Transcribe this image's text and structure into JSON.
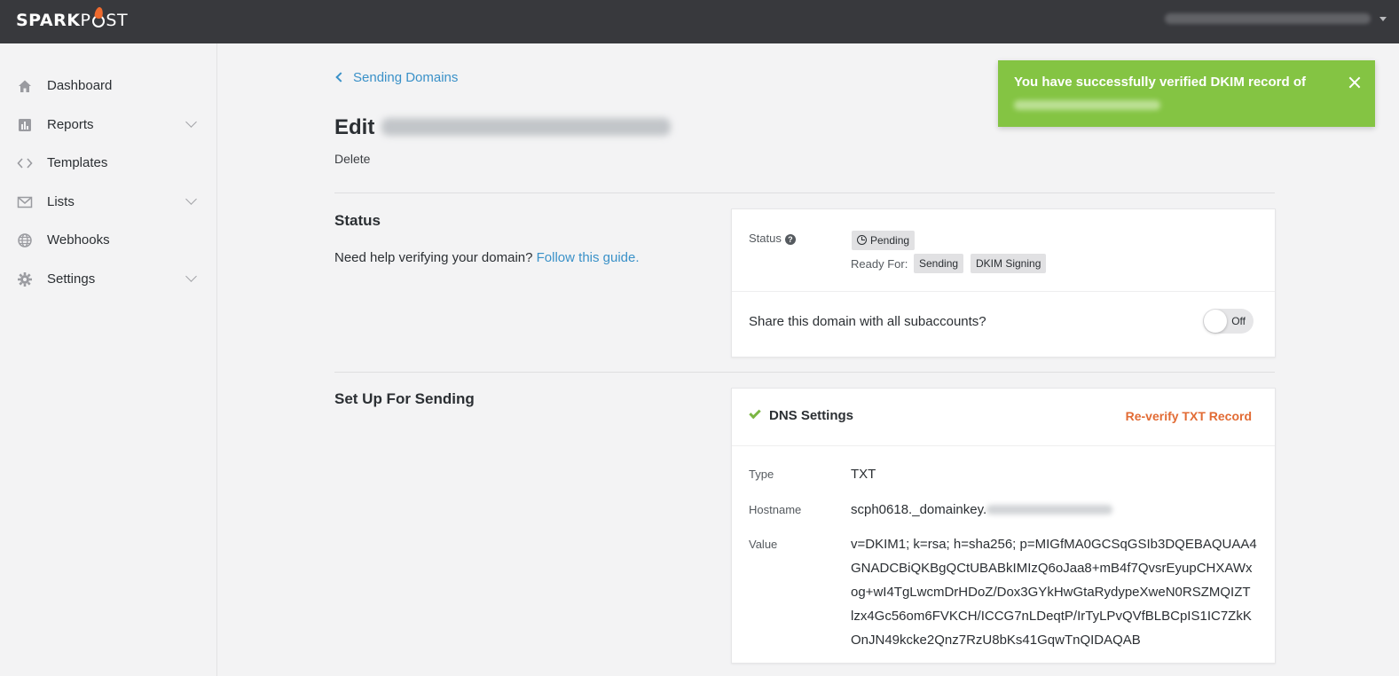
{
  "app": {
    "logo_left": "SPARK",
    "logo_right": "ST"
  },
  "sidebar": {
    "items": [
      {
        "label": "Dashboard",
        "icon": "home-icon",
        "expandable": false
      },
      {
        "label": "Reports",
        "icon": "bar-chart-icon",
        "expandable": true
      },
      {
        "label": "Templates",
        "icon": "code-icon",
        "expandable": false
      },
      {
        "label": "Lists",
        "icon": "envelope-icon",
        "expandable": true
      },
      {
        "label": "Webhooks",
        "icon": "globe-icon",
        "expandable": false
      },
      {
        "label": "Settings",
        "icon": "gear-icon",
        "expandable": true
      }
    ]
  },
  "page": {
    "breadcrumb": "Sending Domains",
    "title_prefix": "Edit",
    "delete_label": "Delete"
  },
  "status_section": {
    "heading": "Status",
    "help_text": "Need help verifying your domain?",
    "help_link": "Follow this guide.",
    "status_label": "Status",
    "status_value": "Pending",
    "ready_for_label": "Ready For:",
    "ready_for_tags": [
      "Sending",
      "DKIM Signing"
    ],
    "share_question": "Share this domain with all subaccounts?",
    "share_toggle": "Off"
  },
  "sending_section": {
    "heading": "Set Up For Sending",
    "dns_title": "DNS Settings",
    "reverify_label": "Re-verify TXT Record",
    "type_label": "Type",
    "type_value": "TXT",
    "hostname_label": "Hostname",
    "hostname_value": "scph0618._domainkey.",
    "value_label": "Value",
    "value_lines": [
      "v=DKIM1; k=rsa; h=sha256; p=MIGfMA0GCSqGSIb3DQEBAQUAA4",
      "GNADCBiQKBgQCtUBABkIMIzQ6oJaa8+mB4f7QvsrEyupCHXAWx",
      "og+wI4TgLwcmDrHDoZ/Dox3GYkHwGtaRydypeXweN0RSZMQIZT",
      "lzx4Gc56om6FVKCH/ICCG7nLDeqtP/IrTyLPvQVfBLBCpIS1IC7ZkK",
      "OnJN49kcke2Qnz7RzU8bKs41GqwTnQIDAQAB"
    ]
  },
  "toast": {
    "message": "You have successfully verified DKIM record of"
  },
  "colors": {
    "topbar": "#38393d",
    "link": "#3a91c8",
    "success": "#84c443",
    "warning_link": "#e26b34"
  }
}
